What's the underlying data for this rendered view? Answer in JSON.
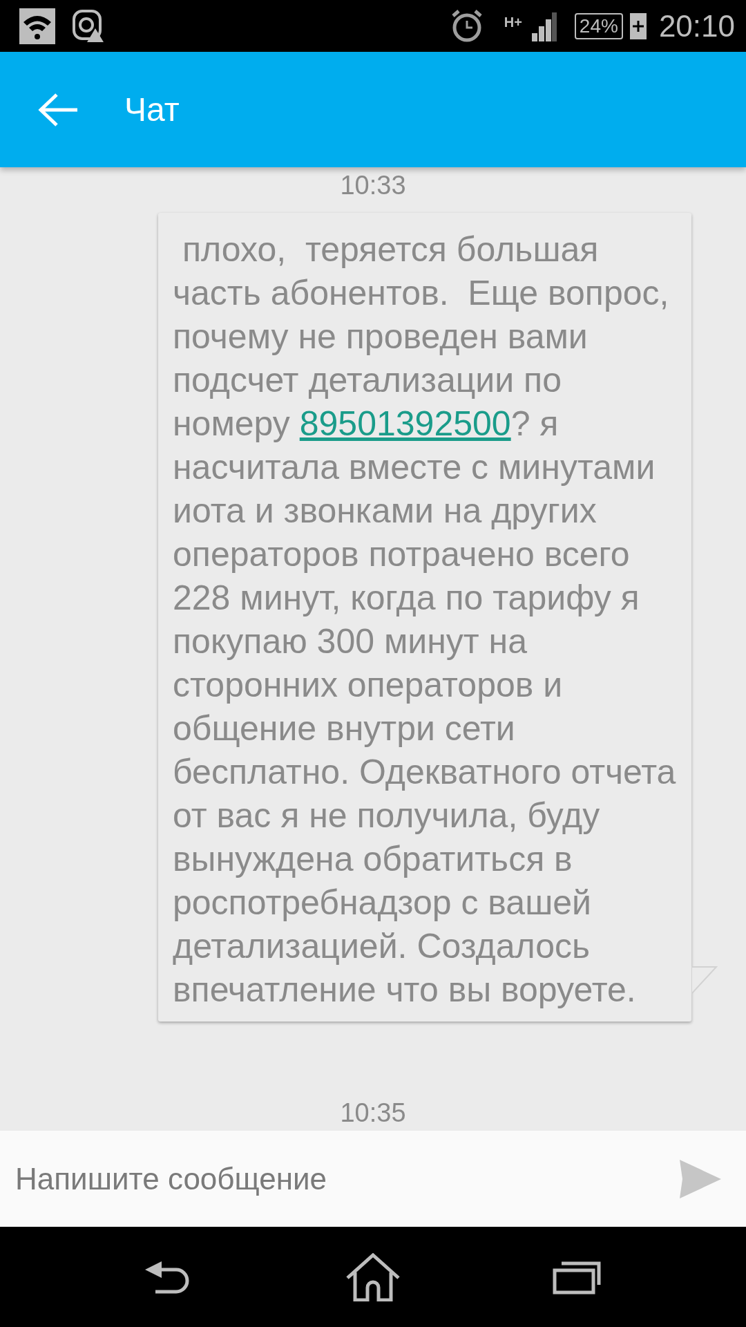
{
  "status_bar": {
    "battery": "24%",
    "time": "20:10",
    "network": "H+"
  },
  "app_bar": {
    "title": "Чат"
  },
  "messages": [
    {
      "kind": "timestamp",
      "text": "10:33"
    },
    {
      "kind": "bubble",
      "before": " плохо,  теряется большая часть абонентов.  Еще вопрос, почему не проведен вами подсчет детализации по номеру ",
      "link": "89501392500",
      "after": "? я насчитала вместе с минутами иота и звонками на других операторов потрачено всего 228 минут, когда по тарифу я покупаю 300 минут на сторонних операторов и общение внутри сети бесплатно. Одекватного отчета от вас я не получила, буду вынуждена обратиться в роспотребнадзор с вашей детализацией. Создалось впечатление что вы воруете."
    },
    {
      "kind": "timestamp",
      "text": "10:35"
    }
  ],
  "composer": {
    "placeholder": "Напишите сообщение"
  }
}
